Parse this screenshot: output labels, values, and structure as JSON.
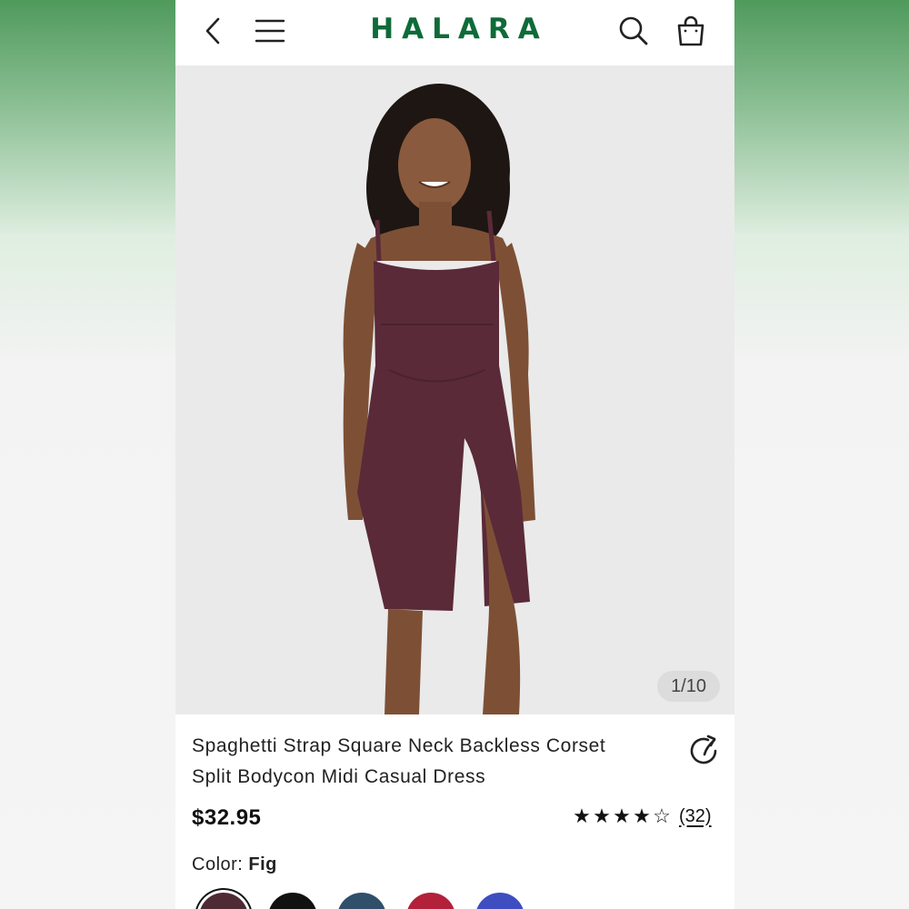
{
  "header": {
    "brand": "HALARA",
    "icons": [
      "back-arrow-icon",
      "menu-icon",
      "search-icon",
      "shopping-bag-icon"
    ],
    "brand_color": "#0e6b38"
  },
  "gallery": {
    "counter": "1/10",
    "product_color": "#5a2a38"
  },
  "product": {
    "title_line1": "Spaghetti Strap Square Neck Backless Corset",
    "title_line2": "Split Bodycon Midi Casual Dress",
    "price": "$32.95",
    "rating": {
      "filled_stars": 4,
      "total_stars": 5,
      "review_count": "(32)"
    },
    "color_label": "Color:",
    "color_value": "Fig",
    "swatches": [
      {
        "name": "Fig",
        "hex": "#4e2a34",
        "selected": true
      },
      {
        "name": "Black",
        "hex": "#111111",
        "selected": false
      },
      {
        "name": "Teal",
        "hex": "#2f4f6a",
        "selected": false
      },
      {
        "name": "Red",
        "hex": "#b3203a",
        "selected": false
      },
      {
        "name": "Blue",
        "hex": "#3e4ec0",
        "selected": false
      }
    ]
  }
}
